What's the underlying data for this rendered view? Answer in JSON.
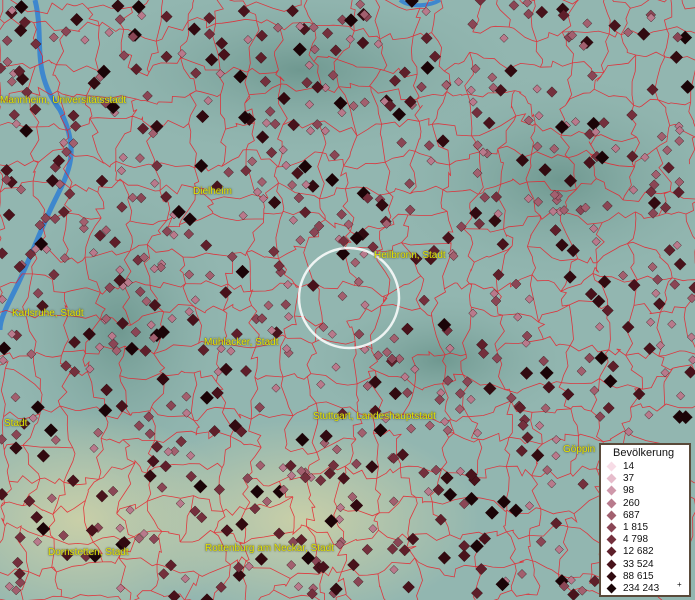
{
  "cities": [
    {
      "name": "Mannheim, Universitätsstadt"
    },
    {
      "name": "Dielheim"
    },
    {
      "name": "Heilbronn, Stadt"
    },
    {
      "name": "Karlsruhe, Stadt"
    },
    {
      "name": "Mühlacker, Stadt"
    },
    {
      "name": "Stuttgart, Landeshauptstadt"
    },
    {
      "name": "Stadt"
    },
    {
      "name": "Göppin"
    },
    {
      "name": "Dornstetten, Stadt"
    },
    {
      "name": "Rottenburg am Neckar, Stadt"
    }
  ],
  "legend": {
    "title": "Bevölkerung",
    "items": [
      {
        "label": "14",
        "color": "#f7dce6"
      },
      {
        "label": "37",
        "color": "#e6bccb"
      },
      {
        "label": "98",
        "color": "#cf98aa"
      },
      {
        "label": "260",
        "color": "#b87a8c"
      },
      {
        "label": "687",
        "color": "#a2606f"
      },
      {
        "label": "1 815",
        "color": "#8a4655"
      },
      {
        "label": "4 798",
        "color": "#74303d"
      },
      {
        "label": "12 682",
        "color": "#5e1f2a"
      },
      {
        "label": "33 524",
        "color": "#48121b"
      },
      {
        "label": "88 615",
        "color": "#310a10"
      },
      {
        "label": "234 243",
        "color": "#1a0407"
      }
    ],
    "plus": "+"
  },
  "colors": {
    "boundary": "#e8202a",
    "highlight_circle": "#ffffff",
    "river": "#2f7fd4"
  }
}
